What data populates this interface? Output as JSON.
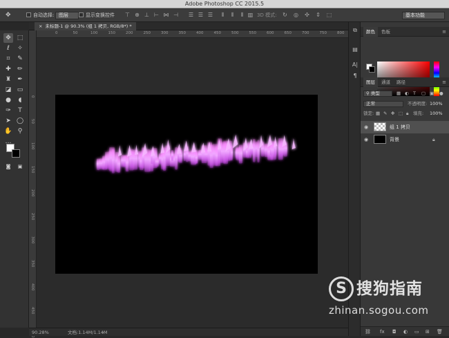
{
  "window": {
    "title": "Adobe Photoshop CC 2015.5"
  },
  "options_bar": {
    "move_icon": "move-icon",
    "auto_select_label": "自动选择:",
    "auto_select_value": "图层",
    "show_transform_label": "显示变换控件",
    "mode_3d_label": "3D 模式:",
    "workspace": "基本功能"
  },
  "document": {
    "tab_label": "未标题-1 @ 90.3% (组 1 拷贝, RGB/8*) *",
    "canvas_color": "#000000",
    "pasteboard_color": "#2b2b2b",
    "glow_color": "#e070ff"
  },
  "rulers": {
    "h_ticks": [
      "0",
      "50",
      "100",
      "150",
      "200",
      "250",
      "300",
      "350",
      "400",
      "450",
      "500",
      "550",
      "600",
      "650",
      "700",
      "750",
      "800"
    ],
    "v_ticks": [
      "0",
      "50",
      "100",
      "150",
      "200",
      "250",
      "300",
      "350",
      "400",
      "450",
      "500"
    ]
  },
  "status": {
    "zoom": "90.28%",
    "doc_size": "文档:1.14M/1.14M"
  },
  "color_panel": {
    "tabs": [
      "颜色",
      "色板"
    ],
    "active_tab": "颜色",
    "foreground": "#ffffff",
    "background": "#000000",
    "hue": "#ff0000"
  },
  "layers_panel": {
    "tabs": [
      "图层",
      "通道",
      "路径"
    ],
    "active_tab": "图层",
    "filter_kind": "类型",
    "blend_mode": "正常",
    "opacity_label": "不透明度:",
    "opacity": "100%",
    "lock_label": "锁定:",
    "fill_label": "填充:",
    "fill": "100%",
    "layers": [
      {
        "name": "组 1 拷贝",
        "selected": true
      },
      {
        "name": "背景",
        "selected": false
      }
    ],
    "bottom_icons": [
      "link-icon",
      "fx-icon",
      "mask-icon",
      "adjustment-icon",
      "folder-icon",
      "new-layer-icon",
      "trash-icon"
    ],
    "bottom_labels": [
      "fx"
    ]
  },
  "watermark": {
    "logo": "S",
    "cn": "搜狗指南",
    "url": "zhinan.sogou.com"
  }
}
